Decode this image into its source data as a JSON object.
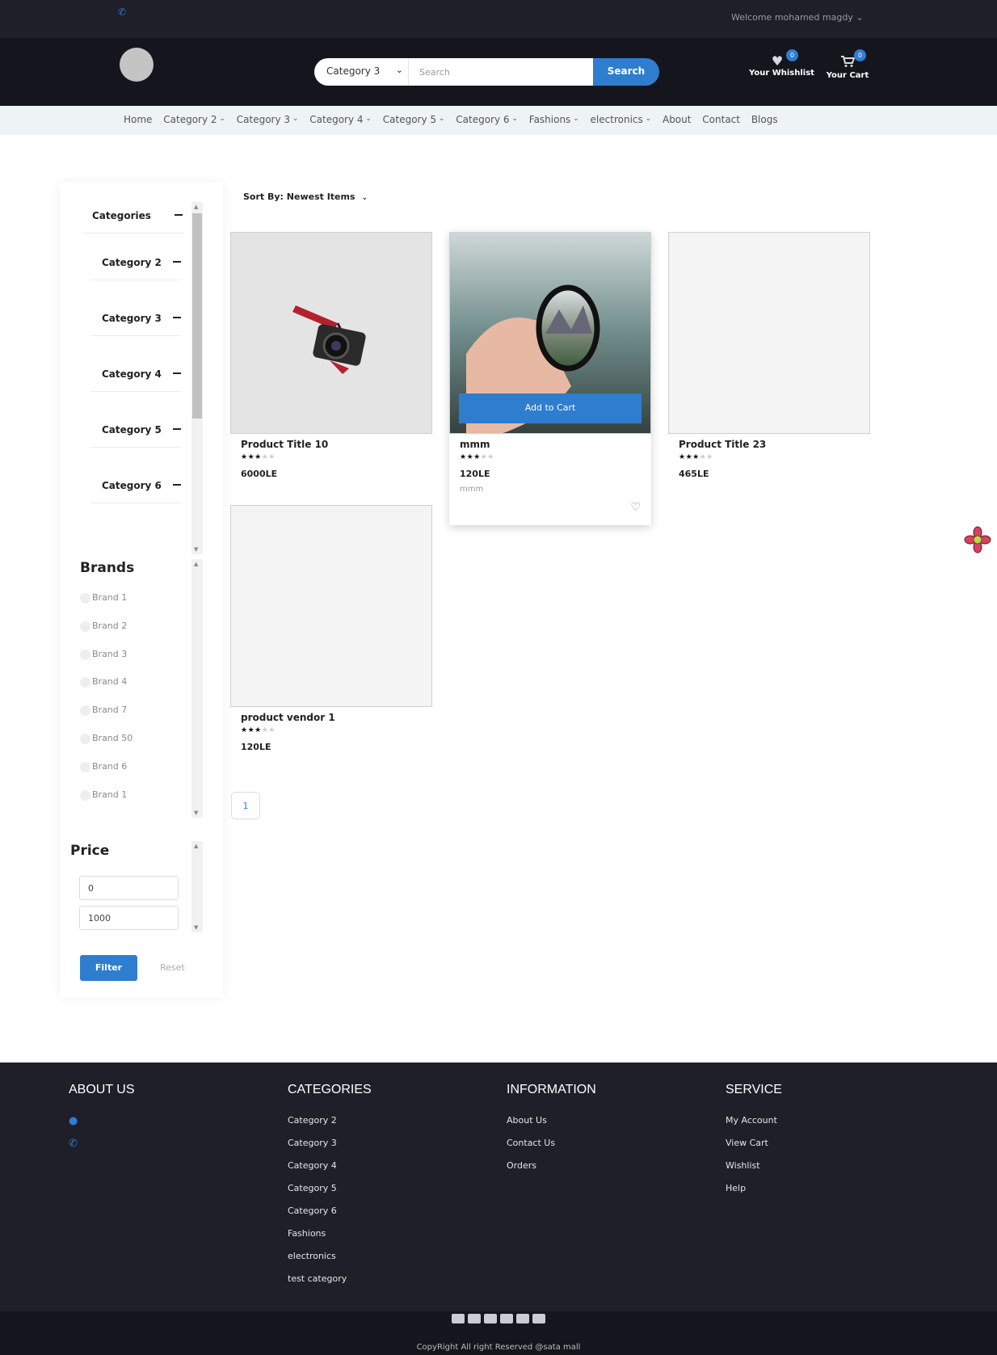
{
  "topbar": {
    "welcome": "Welcome mohamed magdy ⌄"
  },
  "header": {
    "search": {
      "category": "Category 3",
      "placeholder": "Search",
      "button": "Search"
    },
    "wishlist": {
      "label": "Your Whishlist",
      "count": "0"
    },
    "cart": {
      "label": "Your Cart",
      "count": "0"
    }
  },
  "nav": [
    "Home",
    "Category 2",
    "Category 3",
    "Category 4",
    "Category 5",
    "Category 6",
    "Fashions",
    "electronics",
    "About",
    "Contact",
    "Blogs"
  ],
  "sidebar": {
    "categories_title": "Categories",
    "categories": [
      "Category 2",
      "Category 3",
      "Category 4",
      "Category 5",
      "Category 6"
    ],
    "brands_title": "Brands",
    "brands": [
      "Brand 1",
      "Brand 2",
      "Brand 3",
      "Brand 4",
      "Brand 7",
      "Brand 50",
      "Brand 6",
      "Brand 1"
    ],
    "price_title": "Price",
    "price_min": "0",
    "price_max": "1000",
    "filter": "Filter",
    "reset": "Reset"
  },
  "sort_label": "Sort By: Newest Items",
  "products": [
    {
      "title": "Product Title 10",
      "price": "6000LE",
      "rating": 3
    },
    {
      "title": "mmm",
      "price": "120LE",
      "rating": 3,
      "subtitle": "mmm",
      "add_to_cart": "Add to Cart"
    },
    {
      "title": "Product Title 23",
      "price": "465LE",
      "rating": 3
    },
    {
      "title": "product vendor 1",
      "price": "120LE",
      "rating": 3
    }
  ],
  "pagination": {
    "current": "1"
  },
  "footer": {
    "about": {
      "title": "ABOUT US"
    },
    "categories": {
      "title": "CATEGORIES",
      "links": [
        "Category 2",
        "Category 3",
        "Category 4",
        "Category 5",
        "Category 6",
        "Fashions",
        "electronics",
        "test category"
      ]
    },
    "information": {
      "title": "INFORMATION",
      "links": [
        "About Us",
        "Contact Us",
        "Orders"
      ]
    },
    "service": {
      "title": "SERVICE",
      "links": [
        "My Account",
        "View Cart",
        "Wishlist",
        "Help"
      ]
    },
    "copyright": "CopyRight All right Reserved @sata mall"
  },
  "colors": {
    "accent": "#2f7dcf",
    "dark": "#15161d",
    "topbar": "#1e1f29"
  }
}
